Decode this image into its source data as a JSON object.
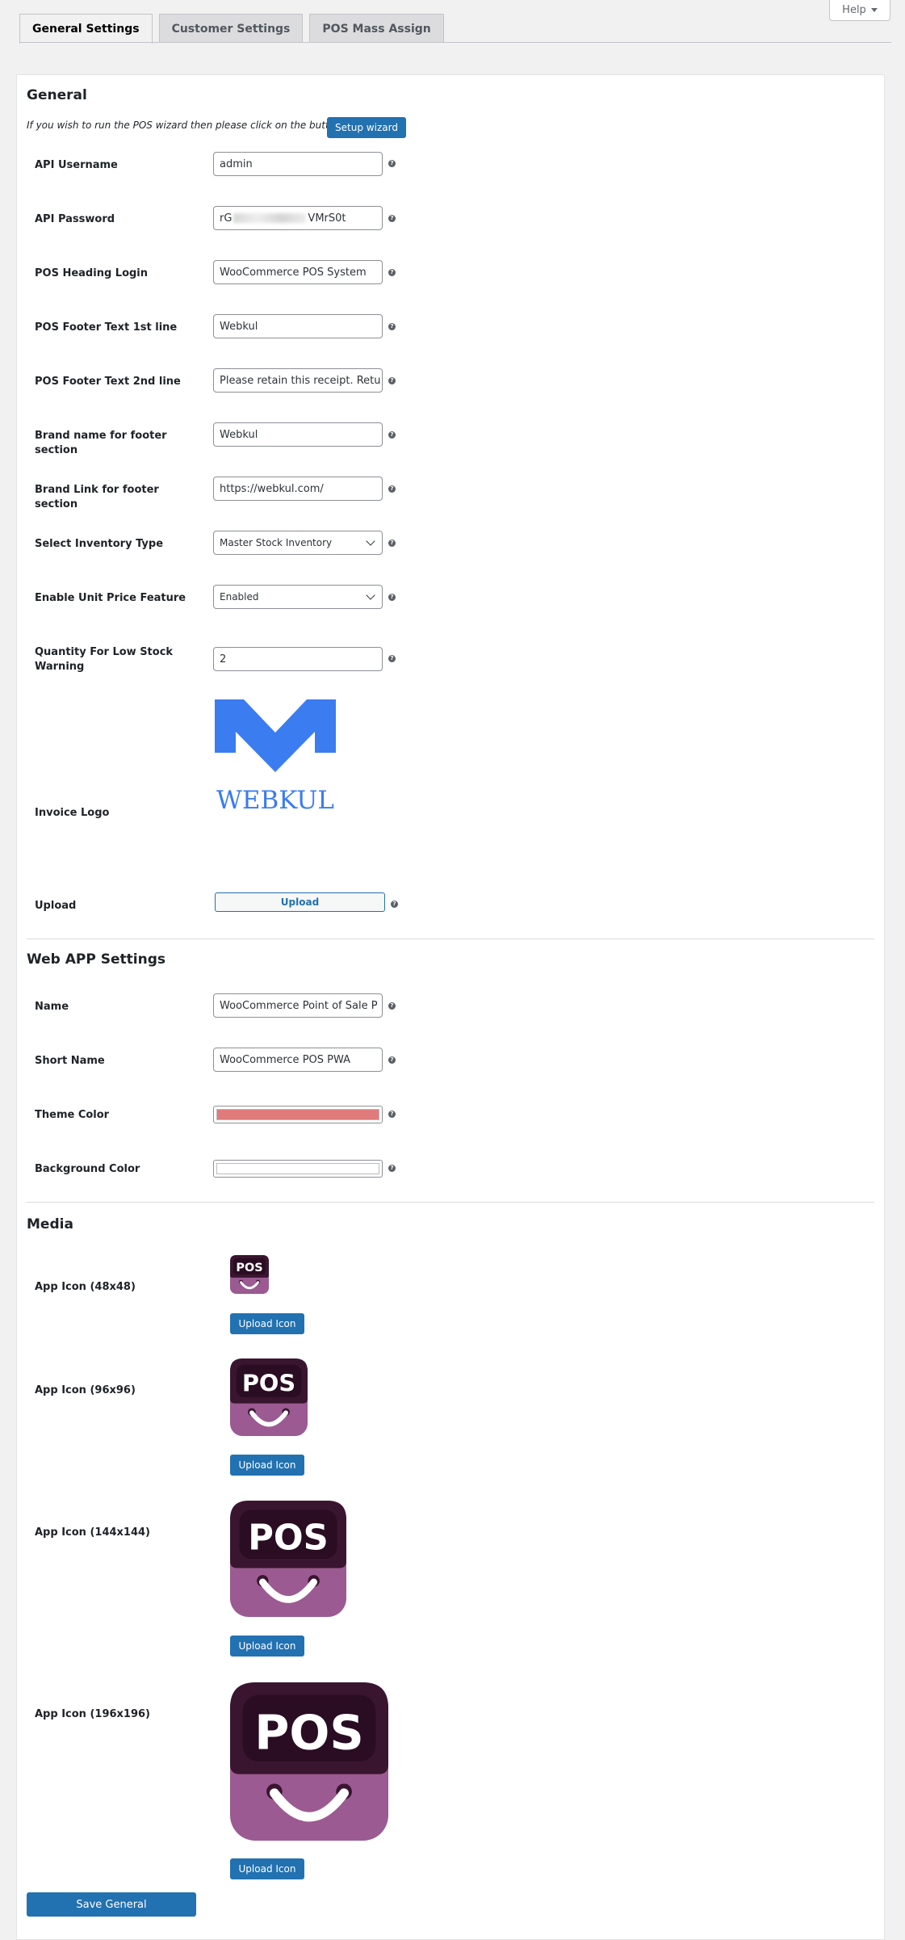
{
  "help": {
    "label": "Help"
  },
  "tabs": [
    {
      "label": "General Settings",
      "active": true
    },
    {
      "label": "Customer Settings",
      "active": false
    },
    {
      "label": "POS Mass Assign",
      "active": false
    }
  ],
  "general": {
    "title": "General",
    "wizard_text": "If you wish to run the POS wizard then please click on the button",
    "wizard_button": "Setup wizard",
    "fields": {
      "api_username": {
        "label": "API Username",
        "value": "admin"
      },
      "api_password": {
        "label": "API Password",
        "value_start": "rG",
        "value_end": "VMrS0t"
      },
      "pos_heading_login": {
        "label": "POS Heading Login",
        "value": "WooCommerce POS System"
      },
      "footer_1": {
        "label": "POS Footer Text 1st line",
        "value": "Webkul"
      },
      "footer_2": {
        "label": "POS Footer Text 2nd line",
        "value": "Please retain this receipt. Retu"
      },
      "brand_name": {
        "label": "Brand name for footer section",
        "value": "Webkul"
      },
      "brand_link": {
        "label": "Brand Link for footer section",
        "value": "https://webkul.com/"
      },
      "inventory_type": {
        "label": "Select Inventory Type",
        "value": "Master Stock Inventory"
      },
      "unit_price": {
        "label": "Enable Unit Price Feature",
        "value": "Enabled"
      },
      "low_stock": {
        "label": "Quantity For Low Stock Warning",
        "value": "2"
      },
      "invoice_logo": {
        "label": "Invoice Logo",
        "logo_text": "WEBKUL",
        "logo_color": "#3b7cf0"
      },
      "upload": {
        "label": "Upload",
        "button": "Upload"
      }
    }
  },
  "webapp": {
    "title": "Web APP Settings",
    "name": {
      "label": "Name",
      "value": "WooCommerce Point of Sale P"
    },
    "short_name": {
      "label": "Short Name",
      "value": "WooCommerce POS PWA"
    },
    "theme_color": {
      "label": "Theme Color",
      "value": "#e07b7b"
    },
    "background_color": {
      "label": "Background Color",
      "value": "#ffffff"
    }
  },
  "media": {
    "title": "Media",
    "icon_text": "POS",
    "icons": [
      {
        "label": "App Icon (48x48)",
        "button": "Upload Icon"
      },
      {
        "label": "App Icon (96x96)",
        "button": "Upload Icon"
      },
      {
        "label": "App Icon (144x144)",
        "button": "Upload Icon"
      },
      {
        "label": "App Icon (196x196)",
        "button": "Upload Icon"
      }
    ],
    "icon_colors": {
      "top": "#3a1530",
      "bottom": "#9b5a91",
      "smile": "#ffffff"
    }
  },
  "save_button": "Save General",
  "colors": {
    "primary": "#2271b1"
  }
}
